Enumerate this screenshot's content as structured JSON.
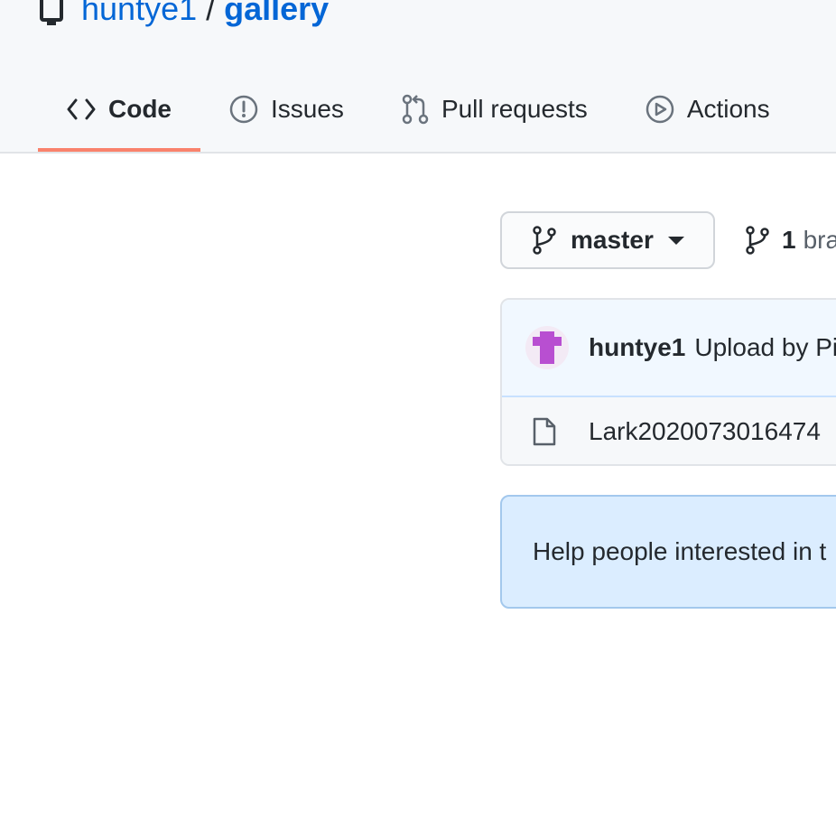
{
  "repo": {
    "owner": "huntye1",
    "separator": "/",
    "name": "gallery"
  },
  "tabs": [
    {
      "label": "Code",
      "icon": "code-icon",
      "selected": true
    },
    {
      "label": "Issues",
      "icon": "issue-icon",
      "selected": false
    },
    {
      "label": "Pull requests",
      "icon": "pull-request-icon",
      "selected": false
    },
    {
      "label": "Actions",
      "icon": "play-icon",
      "selected": false
    }
  ],
  "branch": {
    "current": "master",
    "count": "1",
    "count_label": "bra"
  },
  "commit": {
    "author": "huntye1",
    "message": "Upload by Pi"
  },
  "files": [
    {
      "name": "Lark2020073016474",
      "icon": "file-icon"
    }
  ],
  "help": {
    "text": "Help people interested in t"
  },
  "colors": {
    "link": "#0366d6",
    "tab_underline": "#f9826c",
    "help_bg": "#dbedff",
    "commit_bg": "#f1f8ff",
    "avatar": "#b84fd1"
  }
}
